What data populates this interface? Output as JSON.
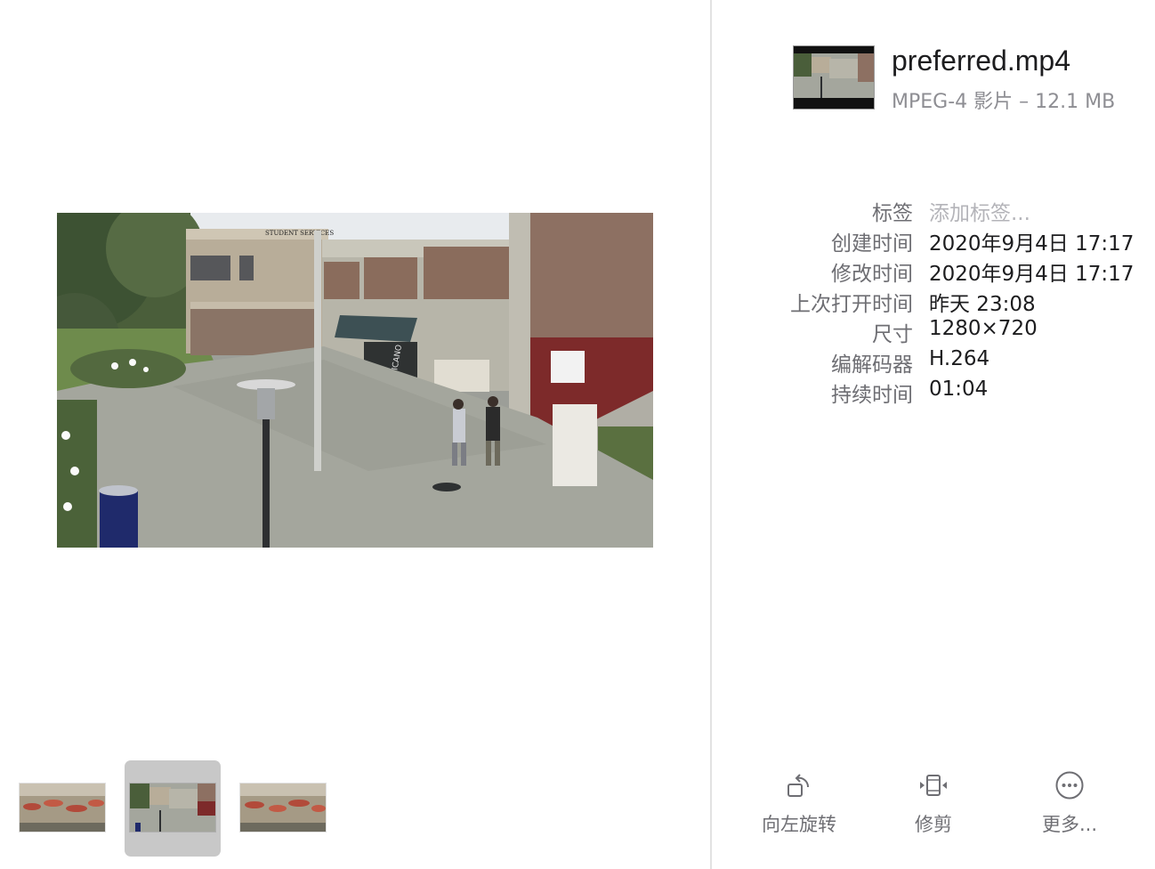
{
  "file": {
    "name": "preferred.mp4",
    "subtitle": "MPEG-4 影片 – 12.1 MB"
  },
  "metadata": [
    {
      "key": "标签",
      "value": "添加标签...",
      "placeholder": true
    },
    {
      "key": "创建时间",
      "value": "2020年9月4日 17:17"
    },
    {
      "key": "修改时间",
      "value": "2020年9月4日 17:17"
    },
    {
      "key": "上次打开时间",
      "value": "昨天 23:08"
    },
    {
      "key": "尺寸",
      "value": "1280×720"
    },
    {
      "key": "编解码器",
      "value": "H.264"
    },
    {
      "key": "持续时间",
      "value": "01:04"
    }
  ],
  "preview": {
    "sign_text": "STUDENT SERVICES",
    "awning_text": "CHICANO"
  },
  "thumbnails": [
    {
      "icon": "outdoor-cafe-thumbnail",
      "selected": false
    },
    {
      "icon": "campus-plaza-thumbnail",
      "selected": true
    },
    {
      "icon": "outdoor-cafe-thumbnail",
      "selected": false
    }
  ],
  "actions": {
    "rotate_label": "向左旋转",
    "trim_label": "修剪",
    "more_label": "更多..."
  },
  "colors": {
    "divider": "#e2e2e2",
    "secondary_text": "#6e6e73",
    "selection": "#c8c8c8"
  }
}
